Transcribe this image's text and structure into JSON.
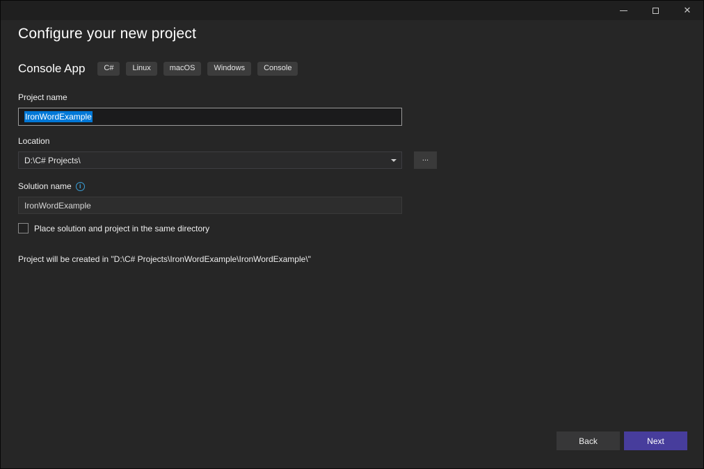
{
  "header": {
    "title": "Configure your new project"
  },
  "template": {
    "name": "Console App",
    "tags": [
      "C#",
      "Linux",
      "macOS",
      "Windows",
      "Console"
    ]
  },
  "form": {
    "project_name": {
      "label": "Project name",
      "value": "IronWordExample",
      "selected": true
    },
    "location": {
      "label": "Location",
      "value": "D:\\C# Projects\\",
      "browse_label": "..."
    },
    "solution_name": {
      "label": "Solution name",
      "info_icon": "i",
      "value": "IronWordExample"
    },
    "same_directory": {
      "label": "Place solution and project in the same directory",
      "checked": false
    },
    "creation_note": "Project will be created in \"D:\\C# Projects\\IronWordExample\\IronWordExample\\\""
  },
  "footer": {
    "back_label": "Back",
    "next_label": "Next"
  },
  "colors": {
    "dialog_background": "#262626",
    "titlebar_background": "#1f1f1f",
    "accent_next_button": "#473d9c",
    "text_selection": "#0078d7",
    "info_icon": "#3aa0d8",
    "tag_background": "#3c3c3c"
  }
}
